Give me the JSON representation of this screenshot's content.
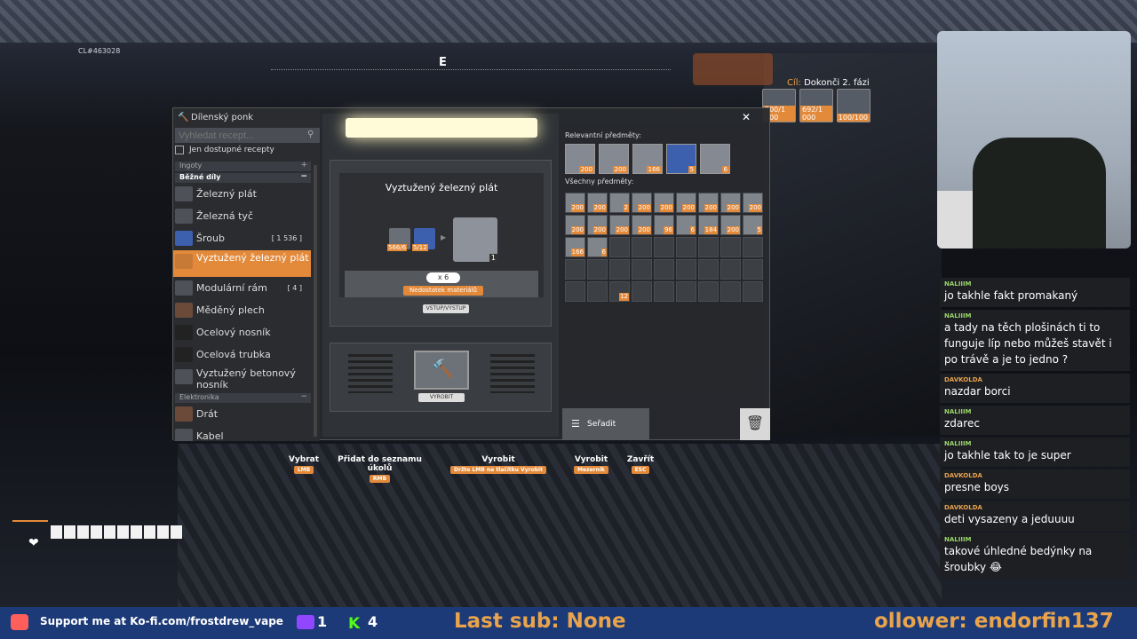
{
  "hud": {
    "cl_id": "CL#463028",
    "compass_letter": "E",
    "goal_prefix": "Cíl:",
    "goal_text": "Dokonči 2. fázi",
    "goal_items": [
      "200/1 000",
      "692/1 000",
      "100/100"
    ]
  },
  "workbench": {
    "title": "Dílenský ponk",
    "search_placeholder": "Vyhledat recept...",
    "only_available_label": "Jen dostupné recepty",
    "categories": [
      {
        "label": "Ingoty",
        "sign": "+"
      },
      {
        "label": "Běžné díly",
        "sign": "−"
      },
      {
        "label": "Elektronika",
        "sign": "−"
      }
    ],
    "items": [
      {
        "label": "Železný plát",
        "count": ""
      },
      {
        "label": "Železná tyč",
        "count": ""
      },
      {
        "label": "Šroub",
        "count": "[ 1 536 ]"
      },
      {
        "label": "Vyztužený železný plát",
        "count": ""
      },
      {
        "label": "Modulární rám",
        "count": "[ 4 ]"
      },
      {
        "label": "Měděný plech",
        "count": ""
      },
      {
        "label": "Ocelový nosník",
        "count": ""
      },
      {
        "label": "Ocelová trubka",
        "count": ""
      },
      {
        "label": "Vyztužený betonový nosník",
        "count": ""
      },
      {
        "label": "Drát",
        "count": ""
      },
      {
        "label": "Kabel",
        "count": ""
      }
    ],
    "recipe": {
      "title": "Vyztužený železný plát",
      "ingredient1_count": "566/6",
      "ingredient2_count": "5/12",
      "result_count": "1",
      "quantity": "x 6",
      "warning": "Nedostatek materiálů",
      "io_label": "VSTUP/VÝSTUP",
      "craft_label": "VYROBIT"
    },
    "relevant_label": "Relevantní předměty:",
    "relevant_items": [
      "200",
      "200",
      "166",
      "5",
      "6"
    ],
    "all_label": "Všechny předměty:",
    "all_items_row1": [
      "200",
      "200",
      "2",
      "200",
      "200",
      "200",
      "200",
      "200",
      "200"
    ],
    "all_items_row2": [
      "200",
      "200",
      "200",
      "200",
      "96",
      "6",
      "184",
      "200",
      "5"
    ],
    "all_items_row3": [
      "166",
      "6"
    ],
    "loose_item": "12",
    "sort_label": "Seřadit"
  },
  "hints": [
    {
      "label": "Vybrat",
      "key": "LMB"
    },
    {
      "label": "Přidat do seznamu úkolů",
      "key": "RMB"
    },
    {
      "label": "Vyrobit",
      "key": "Držte LMB na tlačítku Vyrobit"
    },
    {
      "label": "Vyrobit",
      "key": "Mezerník"
    },
    {
      "label": "Zavřít",
      "key": "ESC"
    }
  ],
  "chat": [
    {
      "user": "NALIIIM",
      "text": "jo takhle fakt promakaný"
    },
    {
      "user": "NALIIIM",
      "text": "a tady na těch plošinách ti to funguje líp nebo můžeš stavět i po trávě a je to jedno ?"
    },
    {
      "user": "DAVKOLDA",
      "text": "nazdar borci"
    },
    {
      "user": "NALIIIM",
      "text": "zdarec"
    },
    {
      "user": "NALIIIM",
      "text": "jo takhle tak to je super"
    },
    {
      "user": "DAVKOLDA",
      "text": "presne boys"
    },
    {
      "user": "DAVKOLDA",
      "text": "deti vysazeny a jeduuuu"
    },
    {
      "user": "NALIIIM",
      "text": "takové úhledné bedýnky na šroubky 😂"
    }
  ],
  "bottom": {
    "kofi_text": "Support me at Ko-fi.com/frostdrew_vape",
    "twitch_count": "1",
    "kick_count": "4",
    "last_sub": "Last sub: None",
    "follower": "ollower: endorfin137"
  },
  "colors": {
    "accent": "#e2893a",
    "bar": "#1c3a78",
    "chat_user_a": "#9bd66a",
    "chat_user_b": "#e9a24b"
  }
}
